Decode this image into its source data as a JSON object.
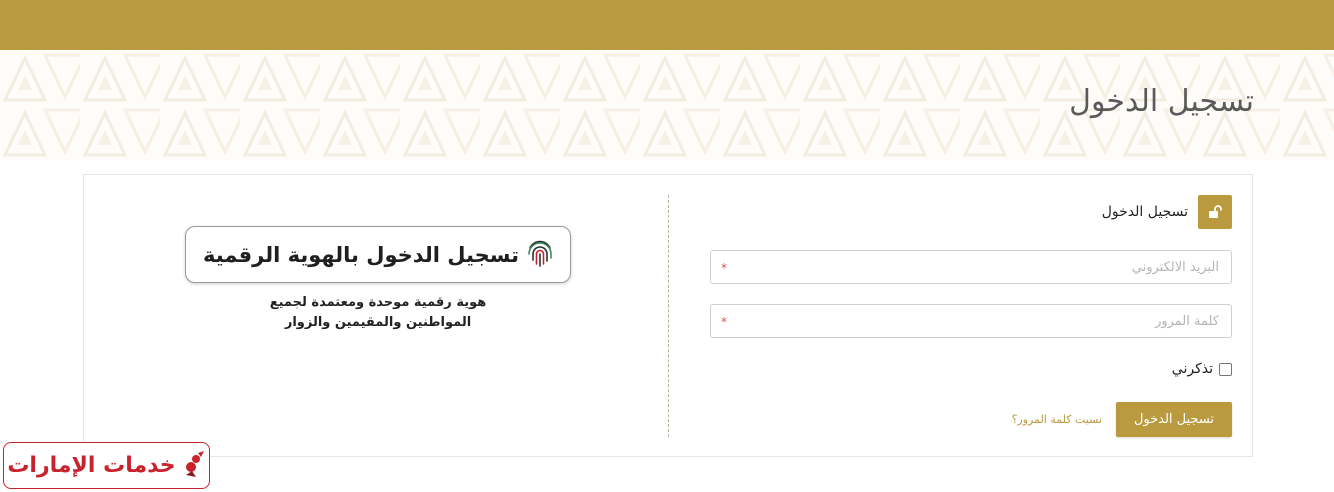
{
  "header": {
    "bar_color": "#b99a3e"
  },
  "page": {
    "title": "تسجيل الدخول"
  },
  "login_form": {
    "section_title": "تسجيل الدخول",
    "section_icon": "unlock-icon",
    "email": {
      "placeholder": "البريد الالكتروني",
      "value": "",
      "required_mark": "*"
    },
    "password": {
      "placeholder": "كلمة المرور",
      "value": "",
      "required_mark": "*"
    },
    "remember_label": "تذكرني",
    "remember_checked": false,
    "submit_label": "تسجيل الدخول",
    "forgot_label": "نسيت كلمة المرور؟"
  },
  "uae_pass": {
    "button_label": "تسجيل الدخول بالهوية الرقمية",
    "button_icon": "fingerprint-icon",
    "description_line1": "هوية رقمية موحدة ومعتمدة لجميع",
    "description_line2": "المواطنين والمقيمين والزوار"
  },
  "footer_logo": {
    "text": "خدمات الإمارات",
    "icon": "falcon-icon",
    "color": "#c8232c"
  },
  "colors": {
    "accent": "#b99a3e",
    "required": "#d9534f",
    "brand_red": "#c8232c"
  }
}
